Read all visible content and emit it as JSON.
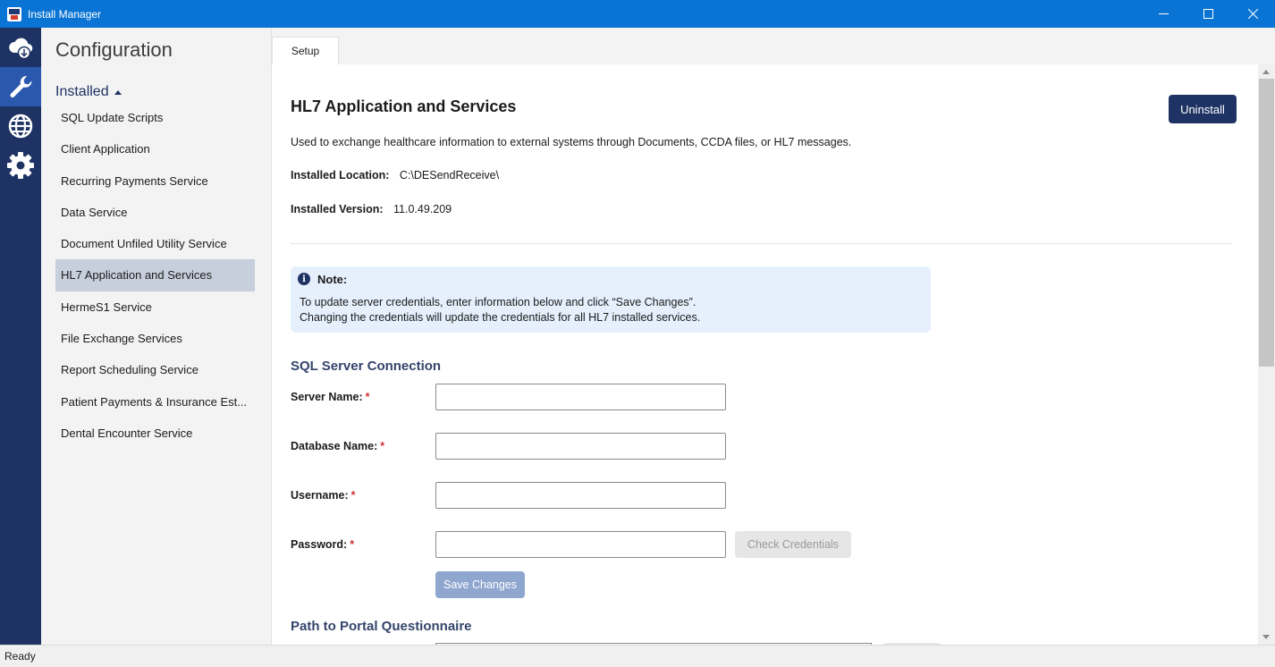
{
  "window": {
    "title": "Install Manager",
    "controls": [
      "minimize",
      "maximize",
      "close"
    ]
  },
  "rail": {
    "items": [
      {
        "icon": "cloud-download-icon",
        "active": false
      },
      {
        "icon": "wrench-icon",
        "active": true
      },
      {
        "icon": "globe-icon",
        "active": false
      },
      {
        "icon": "gear-icon",
        "active": false
      }
    ]
  },
  "nav": {
    "title": "Configuration",
    "section": "Installed",
    "items": [
      "SQL Update Scripts",
      "Client Application",
      "Recurring Payments Service",
      "Data Service",
      "Document Unfiled Utility Service",
      "HL7 Application and Services",
      "HermeS1 Service",
      "File Exchange Services",
      "Report Scheduling Service",
      "Patient Payments & Insurance Est...",
      "Dental Encounter Service"
    ],
    "active_index": 5
  },
  "tabs": [
    {
      "label": "Setup"
    }
  ],
  "main": {
    "title": "HL7 Application and Services",
    "uninstall_label": "Uninstall",
    "description": "Used to exchange healthcare information to external systems through Documents, CCDA files, or HL7 messages.",
    "installed_location_label": "Installed Location:",
    "installed_location": "C:\\DESendReceive\\",
    "installed_version_label": "Installed Version:",
    "installed_version": "11.0.49.209",
    "note": {
      "title": "Note:",
      "line1": "To update server credentials, enter information below and click “Save Changes”.",
      "line2": "Changing the credentials will update the credentials for all HL7 installed services."
    },
    "sql_section_title": "SQL Server Connection",
    "fields": {
      "server_name": {
        "label": "Server Name:",
        "value": ""
      },
      "database_name": {
        "label": "Database Name:",
        "value": ""
      },
      "username": {
        "label": "Username:",
        "value": ""
      },
      "password": {
        "label": "Password:",
        "value": ""
      }
    },
    "required_marker": "*",
    "check_credentials_label": "Check Credentials",
    "save_changes_label": "Save Changes",
    "portal_section_title": "Path to Portal Questionnaire"
  },
  "status": {
    "text": "Ready"
  },
  "colors": {
    "titlebar": "#0a74d4",
    "rail": "#1e3363",
    "rail_active": "#2a58ad",
    "primary_button": "#1e3363",
    "note_bg": "#e5f0fc",
    "nav_active": "#c7cedc",
    "required": "#d13438"
  }
}
